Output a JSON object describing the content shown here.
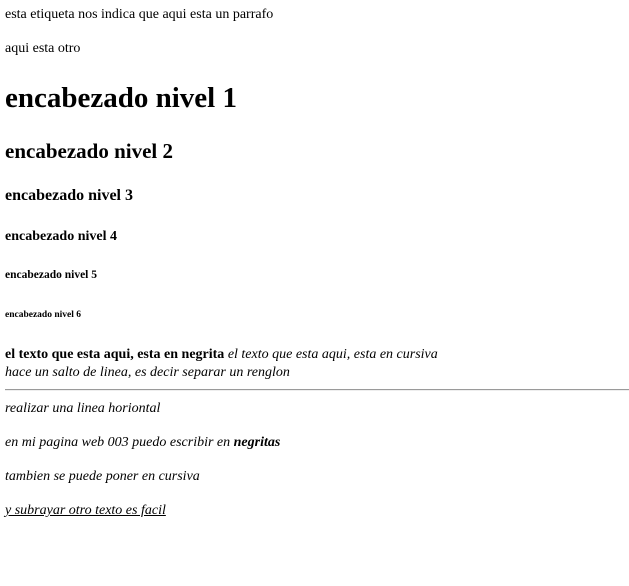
{
  "paragraphs": {
    "p1": "esta etiqueta nos indica que aqui esta un parrafo",
    "p2": "aqui esta otro"
  },
  "headings": {
    "h1": "encabezado nivel 1",
    "h2": "encabezado nivel 2",
    "h3": "encabezado nivel 3",
    "h4": "encabezado nivel 4",
    "h5": "encabezado nivel 5",
    "h6": "encabezado nivel 6"
  },
  "mixed": {
    "bold_text": "el texto que esta aqui, esta en negrita",
    "italic_text": "el texto que esta aqui, esta en cursiva",
    "line_break_text": "hace un salto de linea, es decir separar un renglon"
  },
  "after_rule": {
    "hr_caption": "realizar una linea horiontal",
    "web_text": "en mi pagina web 003 puedo escribir en ",
    "web_bold": "negritas",
    "cursive": "tambien se puede poner en cursiva",
    "underline": "y subrayar otro texto es facil"
  }
}
